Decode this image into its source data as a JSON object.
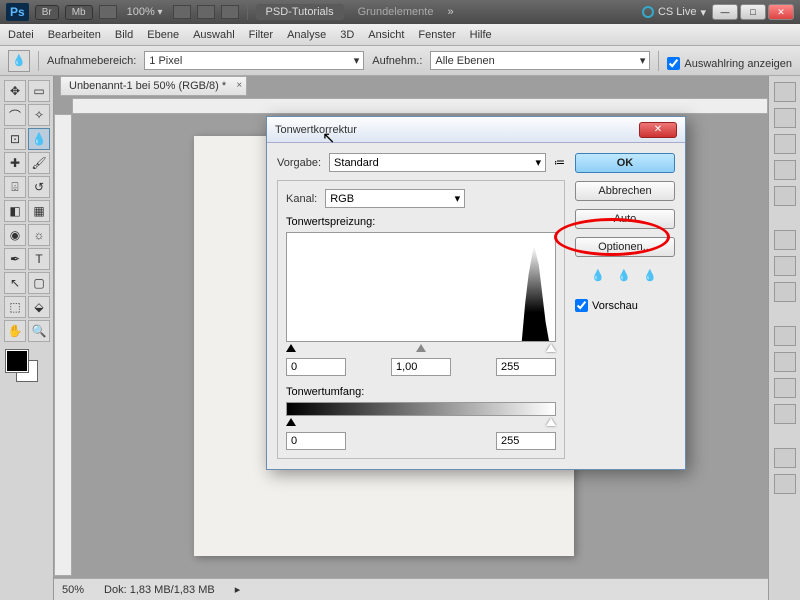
{
  "titlebar": {
    "ps": "Ps",
    "br": "Br",
    "mb": "Mb",
    "zoom": "100%",
    "psd_tutorials": "PSD-Tutorials",
    "grundelemente": "Grundelemente",
    "cs_live": "CS Live"
  },
  "menu": [
    "Datei",
    "Bearbeiten",
    "Bild",
    "Ebene",
    "Auswahl",
    "Filter",
    "Analyse",
    "3D",
    "Ansicht",
    "Fenster",
    "Hilfe"
  ],
  "options": {
    "aufnahme_label": "Aufnahmebereich:",
    "aufnahme_value": "1 Pixel",
    "aufnehm_label": "Aufnehm.:",
    "aufnehm_value": "Alle Ebenen",
    "ring_label": "Auswahlring anzeigen"
  },
  "doc_tab": "Unbenannt-1 bei 50% (RGB/8) *",
  "status": {
    "zoom": "50%",
    "dok": "Dok: 1,83 MB/1,83 MB"
  },
  "dialog": {
    "title": "Tonwertkorrektur",
    "vorgabe_label": "Vorgabe:",
    "vorgabe_value": "Standard",
    "kanal_label": "Kanal:",
    "kanal_value": "RGB",
    "spreizung_label": "Tonwertspreizung:",
    "in_black": "0",
    "in_gamma": "1,00",
    "in_white": "255",
    "umfang_label": "Tonwertumfang:",
    "out_black": "0",
    "out_white": "255",
    "ok": "OK",
    "abbrechen": "Abbrechen",
    "auto": "Auto",
    "optionen": "Optionen...",
    "vorschau": "Vorschau"
  }
}
